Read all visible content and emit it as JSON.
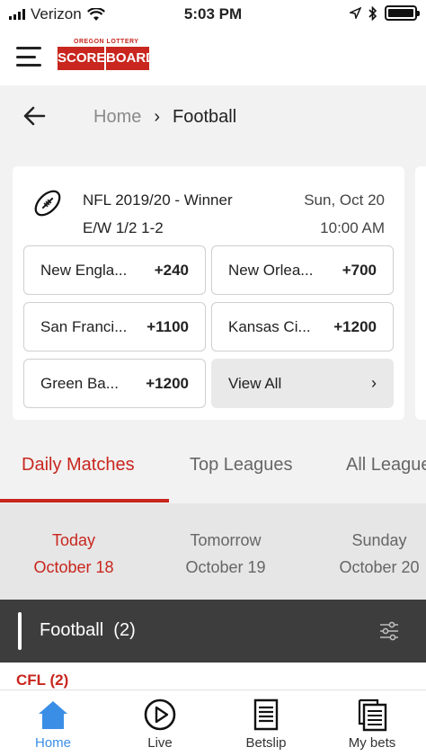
{
  "status_bar": {
    "carrier": "Verizon",
    "time": "5:03 PM"
  },
  "header": {
    "logo": {
      "top_text": "OREGON LOTTERY",
      "word1": "SCORE",
      "word2": "BOARD"
    }
  },
  "breadcrumb": {
    "home": "Home",
    "separator": "›",
    "current": "Football"
  },
  "market_card": {
    "title_line1": "NFL 2019/20 - Winner",
    "title_line2": "E/W 1/2 1-2",
    "date_line1": "Sun, Oct 20",
    "date_line2": "10:00 AM",
    "selections": [
      {
        "team": "New Engla...",
        "odds": "+240"
      },
      {
        "team": "New Orlea...",
        "odds": "+700"
      },
      {
        "team": "San Franci...",
        "odds": "+1100"
      },
      {
        "team": "Kansas Ci...",
        "odds": "+1200"
      },
      {
        "team": "Green Ba...",
        "odds": "+1200"
      }
    ],
    "view_all": "View All",
    "view_all_chevron": "›"
  },
  "tabs": [
    {
      "label": "Daily Matches",
      "active": true
    },
    {
      "label": "Top Leagues",
      "active": false
    },
    {
      "label": "All Leagues",
      "active": false
    }
  ],
  "dates": [
    {
      "day": "Today",
      "date": "October 18",
      "active": true
    },
    {
      "day": "Tomorrow",
      "date": "October 19",
      "active": false
    },
    {
      "day": "Sunday",
      "date": "October 20",
      "active": false
    }
  ],
  "sport_section": {
    "label": "Football",
    "count": "(2)"
  },
  "league": {
    "label": "CFL (2)"
  },
  "bottom_nav": [
    {
      "label": "Home",
      "icon": "home-icon",
      "active": true
    },
    {
      "label": "Live",
      "icon": "play-circle-icon",
      "active": false
    },
    {
      "label": "Betslip",
      "icon": "ticket-icon",
      "active": false
    },
    {
      "label": "My bets",
      "icon": "stacked-tickets-icon",
      "active": false
    }
  ],
  "colors": {
    "accent_red": "#c8261e",
    "nav_active_blue": "#3a8ee6",
    "section_bar": "#3d3d3d"
  }
}
